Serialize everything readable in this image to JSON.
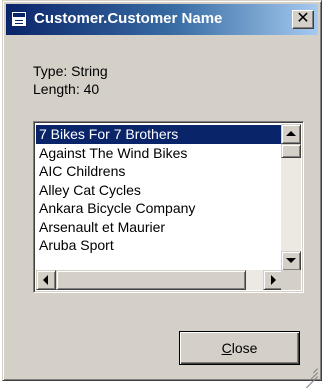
{
  "window": {
    "title": "Customer.Customer Name",
    "close_glyph": "✕"
  },
  "field_info": {
    "type_text": "Type: String",
    "length_text": "Length: 40"
  },
  "list": {
    "selected_index": 0,
    "items": [
      "7 Bikes For 7 Brothers",
      "Against The Wind Bikes",
      "AIC Childrens",
      "Alley Cat Cycles",
      "Ankara Bicycle Company",
      "Arsenault et Maurier",
      "Aruba Sport"
    ]
  },
  "buttons": {
    "close_mnemonic": "C",
    "close_rest": "lose"
  },
  "colors": {
    "title_bar": "#0a246a",
    "selection": "#0a246a",
    "face": "#d4d0c8"
  }
}
